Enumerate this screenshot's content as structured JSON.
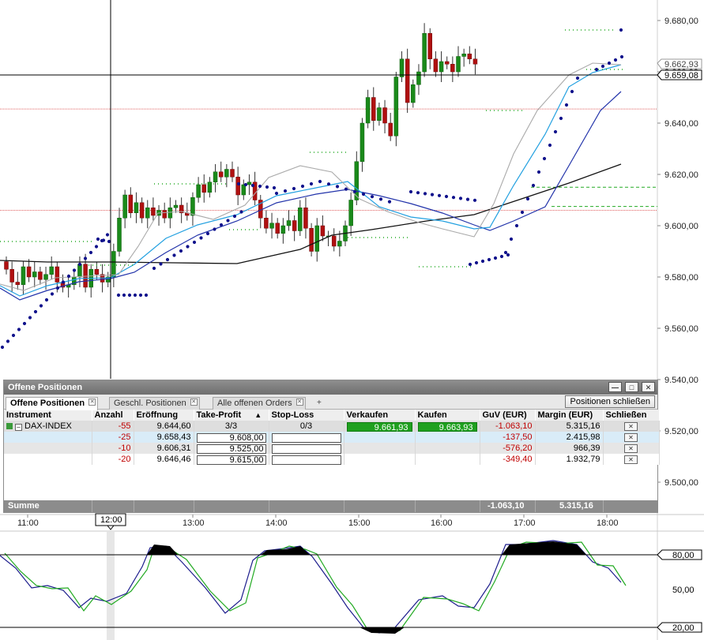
{
  "chart": {
    "price_axis_labels": [
      "9.680,00",
      "9.660,00",
      "9.640,00",
      "9.620,00",
      "9.600,00",
      "9.580,00",
      "9.560,00",
      "9.540,00",
      "9.520,00",
      "9.500,00"
    ],
    "price_tags": {
      "last": "9.662,93",
      "crosshair": "9.659,08"
    },
    "time_labels": [
      "11:00",
      "13:00",
      "14:00",
      "15:00",
      "16:00",
      "17:00",
      "18:00"
    ],
    "time_cursor_label": "12:00",
    "oscillator_labels": [
      "80,00",
      "50,00",
      "20,00"
    ],
    "colors": {
      "up": "#1a8a1a",
      "down": "#b01010",
      "psar": "#10128c",
      "ma_slow": "#111111",
      "ma_blue": "#2233aa",
      "ma_cyan": "#22a0e0",
      "ma_gray": "#aaaaaa",
      "osc_k": "#1c1c8c",
      "osc_d": "#22aa22"
    }
  },
  "panel": {
    "title": "Offene Positionen",
    "window_buttons": [
      "minimize-icon",
      "maximize-icon",
      "close-icon"
    ],
    "tabs": [
      {
        "label": "Offene Positionen",
        "active": true
      },
      {
        "label": "Geschl. Positionen",
        "active": false
      },
      {
        "label": "Alle offenen Orders",
        "active": false
      }
    ],
    "tab_add": "+",
    "close_positions_button": "Positionen schließen",
    "columns": [
      "Instrument",
      "Anzahl",
      "Eröffnung",
      "Take-Profit",
      "Stop-Loss",
      "Verkaufen",
      "Kaufen",
      "GuV (EUR)",
      "Margin (EUR)",
      "Schließen"
    ],
    "sort_indicator": "▲",
    "main_row": {
      "instrument": "DAX-INDEX",
      "anzahl": "-55",
      "eroeffnung": "9.644,60",
      "take_profit": "3/3",
      "stop_loss": "0/3",
      "verkaufen": "9.661,93",
      "kaufen": "9.663,93",
      "guv": "-1.063,10",
      "margin": "5.315,16"
    },
    "sub_rows": [
      {
        "anzahl": "-25",
        "eroeffnung": "9.658,43",
        "take_profit": "9.608,00",
        "stop_loss": "",
        "guv": "-137,50",
        "margin": "2.415,98"
      },
      {
        "anzahl": "-10",
        "eroeffnung": "9.606,31",
        "take_profit": "9.525,00",
        "stop_loss": "",
        "guv": "-576,20",
        "margin": "966,39"
      },
      {
        "anzahl": "-20",
        "eroeffnung": "9.646,46",
        "take_profit": "9.615,00",
        "stop_loss": "",
        "guv": "-349,40",
        "margin": "1.932,79"
      }
    ],
    "summe": {
      "label": "Summe",
      "guv": "-1.063,10",
      "margin": "5.315,16"
    }
  }
}
